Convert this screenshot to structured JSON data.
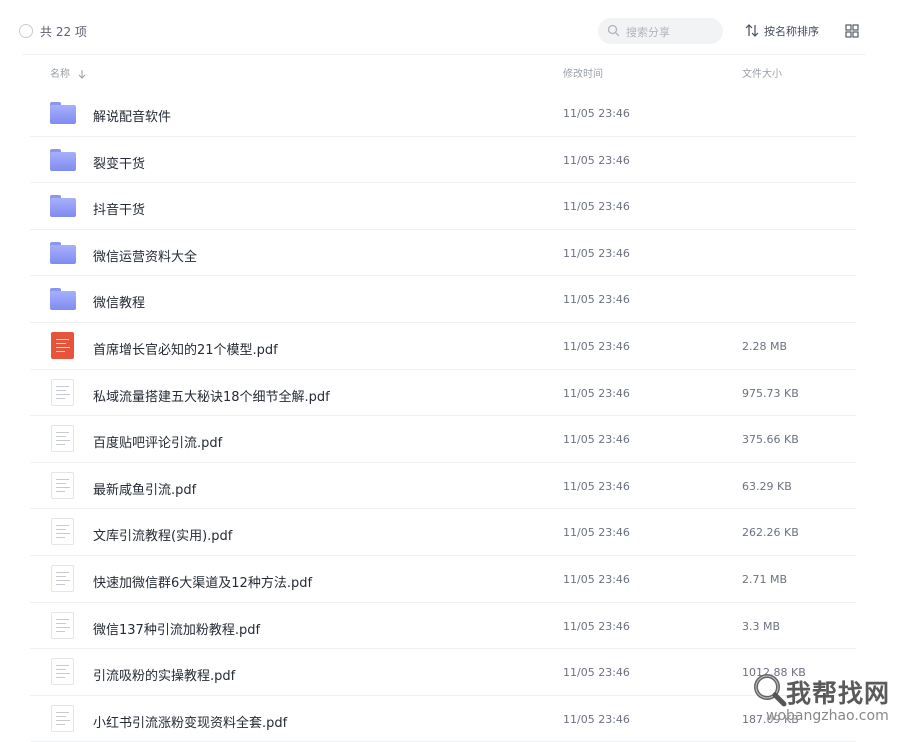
{
  "header": {
    "count_label": "共 22 项",
    "search_placeholder": "搜索分享",
    "sort_label": "按名称排序"
  },
  "columns": {
    "name": "名称",
    "time": "修改时间",
    "size": "文件大小"
  },
  "files": [
    {
      "name": "解说配音软件",
      "time": "11/05 23:46",
      "size": "",
      "type": "folder"
    },
    {
      "name": "裂变干货",
      "time": "11/05 23:46",
      "size": "",
      "type": "folder"
    },
    {
      "name": "抖音干货",
      "time": "11/05 23:46",
      "size": "",
      "type": "folder"
    },
    {
      "name": "微信运营资料大全",
      "time": "11/05 23:46",
      "size": "",
      "type": "folder"
    },
    {
      "name": "微信教程",
      "time": "11/05 23:46",
      "size": "",
      "type": "folder"
    },
    {
      "name": "首席增长官必知的21个模型.pdf",
      "time": "11/05 23:46",
      "size": "2.28 MB",
      "type": "pdf-red"
    },
    {
      "name": "私域流量搭建五大秘诀18个细节全解.pdf",
      "time": "11/05 23:46",
      "size": "975.73 KB",
      "type": "pdf"
    },
    {
      "name": "百度贴吧评论引流.pdf",
      "time": "11/05 23:46",
      "size": "375.66 KB",
      "type": "pdf"
    },
    {
      "name": "最新咸鱼引流.pdf",
      "time": "11/05 23:46",
      "size": "63.29 KB",
      "type": "pdf"
    },
    {
      "name": "文库引流教程(实用).pdf",
      "time": "11/05 23:46",
      "size": "262.26 KB",
      "type": "pdf"
    },
    {
      "name": "快速加微信群6大渠道及12种方法.pdf",
      "time": "11/05 23:46",
      "size": "2.71 MB",
      "type": "pdf"
    },
    {
      "name": "微信137种引流加粉教程.pdf",
      "time": "11/05 23:46",
      "size": "3.3 MB",
      "type": "pdf"
    },
    {
      "name": "引流吸粉的实操教程.pdf",
      "time": "11/05 23:46",
      "size": "1012.88 KB",
      "type": "pdf"
    },
    {
      "name": "小红书引流涨粉变现资料全套.pdf",
      "time": "11/05 23:46",
      "size": "187.09 KB",
      "type": "pdf"
    }
  ],
  "watermark": {
    "text": "我帮找网",
    "url": "wobangzhao.com"
  }
}
